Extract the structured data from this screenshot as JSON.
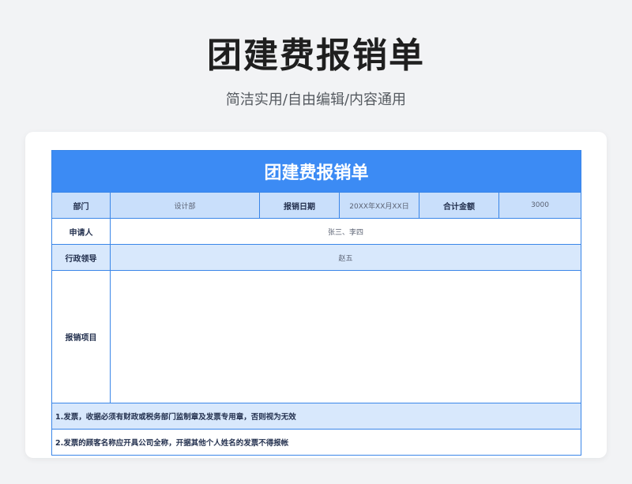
{
  "page": {
    "title": "团建费报销单",
    "subtitle": "简洁实用/自由编辑/内容通用"
  },
  "form": {
    "header": "团建费报销单",
    "department_label": "部门",
    "department_value": "设计部",
    "date_label": "报销日期",
    "date_value": "20XX年XX月XX日",
    "total_label": "合计金额",
    "total_value": "3000",
    "applicant_label": "申请人",
    "applicant_value": "张三、李四",
    "leader_label": "行政领导",
    "leader_value": "赵五",
    "items_label": "报销项目",
    "items_value": "",
    "note1": "1.发票，收据必须有财政或税务部门监制章及发票专用章，否则视为无效",
    "note2": "2.发票的顾客名称应开具公司全称，开据其他个人姓名的发票不得报帐"
  },
  "colors": {
    "header_blue": "#3c8bf4",
    "border_blue": "#3a86e8",
    "row_blue": "#c9dffb",
    "row_light": "#d8e8fc"
  }
}
